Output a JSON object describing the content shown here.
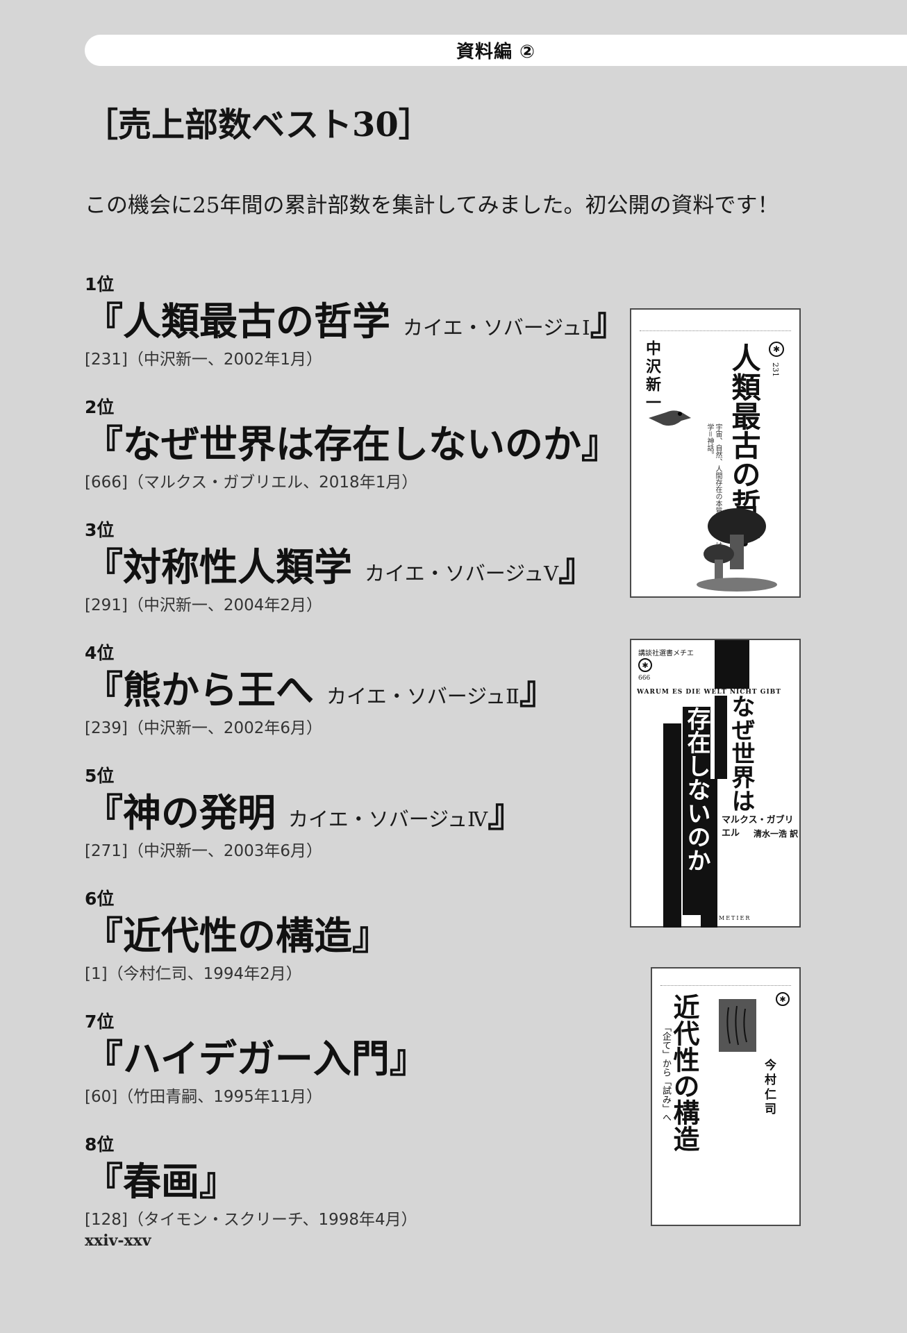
{
  "header": {
    "label": "資料編 ②"
  },
  "section_title": "［売上部数ベスト30］",
  "intro": "この機会に25年間の累計部数を集計してみました。初公開の資料です！",
  "ranking": [
    {
      "rank": "1位",
      "title": "『人類最古の哲学",
      "subtitle": "カイエ・ソバージュⅠ",
      "close": "』",
      "meta": "[231]（中沢新一、2002年1月）"
    },
    {
      "rank": "2位",
      "title": "『なぜ世界は存在しないのか』",
      "subtitle": "",
      "close": "",
      "meta": "[666]（マルクス・ガブリエル、2018年1月）"
    },
    {
      "rank": "3位",
      "title": "『対称性人類学",
      "subtitle": "カイエ・ソバージュⅤ",
      "close": "』",
      "meta": "[291]（中沢新一、2004年2月）"
    },
    {
      "rank": "4位",
      "title": "『熊から王へ",
      "subtitle": "カイエ・ソバージュⅡ",
      "close": "』",
      "meta": "[239]（中沢新一、2002年6月）"
    },
    {
      "rank": "5位",
      "title": "『神の発明",
      "subtitle": "カイエ・ソバージュⅣ",
      "close": "』",
      "meta": "[271]（中沢新一、2003年6月）"
    },
    {
      "rank": "6位",
      "title": "『近代性の構造』",
      "subtitle": "",
      "close": "",
      "meta": "[1]（今村仁司、1994年2月）"
    },
    {
      "rank": "7位",
      "title": "『ハイデガー入門』",
      "subtitle": "",
      "close": "",
      "meta": "[60]（竹田青嗣、1995年11月）"
    },
    {
      "rank": "8位",
      "title": "『春画』",
      "subtitle": "",
      "close": "",
      "meta": "[128]（タイモン・スクリーチ、1998年4月）"
    }
  ],
  "covers": {
    "c1": {
      "title": "人類最古の哲学",
      "author": "中沢新一",
      "number": "231",
      "tagline": "宇宙、自然、人間存在の本質を問う、はじまりの哲学＝神話。"
    },
    "c2": {
      "series": "講談社選書メチエ",
      "number": "666",
      "latin": "WARUM ES DIE WELT NICHT GIBT",
      "title_a": "なぜ世界は",
      "title_b": "存在しないのか",
      "author": "マルクス・ガブリエル",
      "translator": "清水一浩 訳",
      "imprint": "METIER"
    },
    "c3": {
      "title": "近代性の構造",
      "subtitle": "「企て」から「試み」へ",
      "author": "今村仁司"
    }
  },
  "footer": {
    "page": "xxiv-xxv"
  },
  "colors": {
    "background": "#d6d6d6",
    "bar": "#ffffff",
    "text": "#141414"
  }
}
